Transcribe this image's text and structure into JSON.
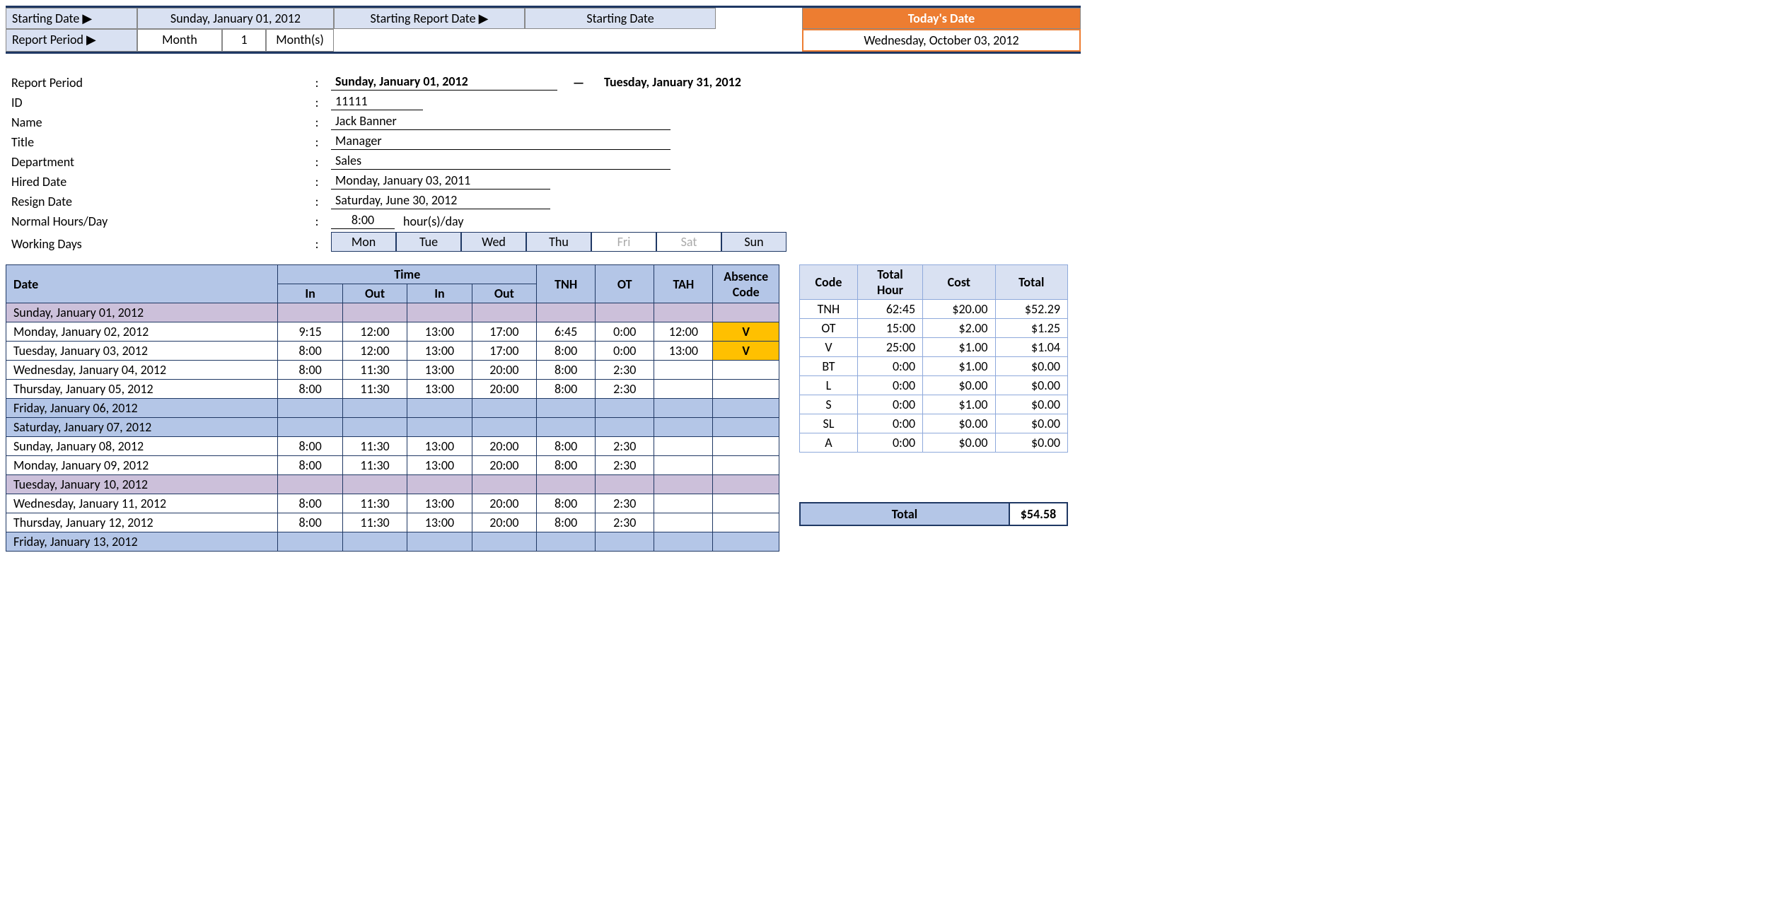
{
  "top": {
    "startingDateLabel": "Starting Date ▶",
    "startingDateValue": "Sunday, January 01, 2012",
    "startingReportDateLabel": "Starting Report Date ▶",
    "startingReportDateValue": "Starting Date",
    "reportPeriodLabel": "Report Period ▶",
    "reportPeriodUnit": "Month",
    "reportPeriodNum": "1",
    "reportPeriodSuffix": "Month(s)",
    "todaysDateLabel": "Today's Date",
    "todaysDateValue": "Wednesday, October 03, 2012"
  },
  "info": {
    "reportPeriodLabel": "Report Period",
    "periodStart": "Sunday, January 01, 2012",
    "periodDash": "—",
    "periodEnd": "Tuesday, January 31, 2012",
    "idLabel": "ID",
    "idValue": "11111",
    "nameLabel": "Name",
    "nameValue": "Jack Banner",
    "titleLabel": "Title",
    "titleValue": "Manager",
    "departmentLabel": "Department",
    "departmentValue": "Sales",
    "hiredDateLabel": "Hired Date",
    "hiredDateValue": "Monday, January 03, 2011",
    "resignDateLabel": "Resign Date",
    "resignDateValue": "Saturday, June 30, 2012",
    "normalHoursLabel": "Normal Hours/Day",
    "normalHoursValue": "8:00",
    "normalHoursSuffix": "hour(s)/day",
    "workingDaysLabel": "Working Days",
    "days": [
      "Mon",
      "Tue",
      "Wed",
      "Thu",
      "Fri",
      "Sat",
      "Sun"
    ]
  },
  "mainTable": {
    "headers": {
      "date": "Date",
      "time": "Time",
      "in": "In",
      "out": "Out",
      "tnh": "TNH",
      "ot": "OT",
      "tah": "TAH",
      "absence": "Absence Code"
    },
    "rows": [
      {
        "cls": "purple",
        "date": "Sunday, January 01, 2012",
        "in1": "",
        "out1": "",
        "in2": "",
        "out2": "",
        "tnh": "",
        "ot": "",
        "tah": "",
        "abs": ""
      },
      {
        "cls": "",
        "date": "Monday, January 02, 2012",
        "in1": "9:15",
        "out1": "12:00",
        "in2": "13:00",
        "out2": "17:00",
        "tnh": "6:45",
        "ot": "0:00",
        "tah": "12:00",
        "abs": "V"
      },
      {
        "cls": "",
        "date": "Tuesday, January 03, 2012",
        "in1": "8:00",
        "out1": "12:00",
        "in2": "13:00",
        "out2": "17:00",
        "tnh": "8:00",
        "ot": "0:00",
        "tah": "13:00",
        "abs": "V"
      },
      {
        "cls": "",
        "date": "Wednesday, January 04, 2012",
        "in1": "8:00",
        "out1": "11:30",
        "in2": "13:00",
        "out2": "20:00",
        "tnh": "8:00",
        "ot": "2:30",
        "tah": "",
        "abs": ""
      },
      {
        "cls": "",
        "date": "Thursday, January 05, 2012",
        "in1": "8:00",
        "out1": "11:30",
        "in2": "13:00",
        "out2": "20:00",
        "tnh": "8:00",
        "ot": "2:30",
        "tah": "",
        "abs": ""
      },
      {
        "cls": "blue",
        "date": "Friday, January 06, 2012",
        "in1": "",
        "out1": "",
        "in2": "",
        "out2": "",
        "tnh": "",
        "ot": "",
        "tah": "",
        "abs": ""
      },
      {
        "cls": "blue",
        "date": "Saturday, January 07, 2012",
        "in1": "",
        "out1": "",
        "in2": "",
        "out2": "",
        "tnh": "",
        "ot": "",
        "tah": "",
        "abs": ""
      },
      {
        "cls": "",
        "date": "Sunday, January 08, 2012",
        "in1": "8:00",
        "out1": "11:30",
        "in2": "13:00",
        "out2": "20:00",
        "tnh": "8:00",
        "ot": "2:30",
        "tah": "",
        "abs": ""
      },
      {
        "cls": "",
        "date": "Monday, January 09, 2012",
        "in1": "8:00",
        "out1": "11:30",
        "in2": "13:00",
        "out2": "20:00",
        "tnh": "8:00",
        "ot": "2:30",
        "tah": "",
        "abs": ""
      },
      {
        "cls": "purple",
        "date": "Tuesday, January 10, 2012",
        "in1": "",
        "out1": "",
        "in2": "",
        "out2": "",
        "tnh": "",
        "ot": "",
        "tah": "",
        "abs": ""
      },
      {
        "cls": "",
        "date": "Wednesday, January 11, 2012",
        "in1": "8:00",
        "out1": "11:30",
        "in2": "13:00",
        "out2": "20:00",
        "tnh": "8:00",
        "ot": "2:30",
        "tah": "",
        "abs": ""
      },
      {
        "cls": "",
        "date": "Thursday, January 12, 2012",
        "in1": "8:00",
        "out1": "11:30",
        "in2": "13:00",
        "out2": "20:00",
        "tnh": "8:00",
        "ot": "2:30",
        "tah": "",
        "abs": ""
      },
      {
        "cls": "blue",
        "date": "Friday, January 13, 2012",
        "in1": "",
        "out1": "",
        "in2": "",
        "out2": "",
        "tnh": "",
        "ot": "",
        "tah": "",
        "abs": ""
      }
    ]
  },
  "summary": {
    "headers": {
      "code": "Code",
      "totalHour": "Total Hour",
      "cost": "Cost",
      "total": "Total"
    },
    "rows": [
      {
        "code": "TNH",
        "hour": "62:45",
        "cost": "$20.00",
        "total": "$52.29"
      },
      {
        "code": "OT",
        "hour": "15:00",
        "cost": "$2.00",
        "total": "$1.25"
      },
      {
        "code": "V",
        "hour": "25:00",
        "cost": "$1.00",
        "total": "$1.04"
      },
      {
        "code": "BT",
        "hour": "0:00",
        "cost": "$1.00",
        "total": "$0.00"
      },
      {
        "code": "L",
        "hour": "0:00",
        "cost": "$0.00",
        "total": "$0.00"
      },
      {
        "code": "S",
        "hour": "0:00",
        "cost": "$1.00",
        "total": "$0.00"
      },
      {
        "code": "SL",
        "hour": "0:00",
        "cost": "$0.00",
        "total": "$0.00"
      },
      {
        "code": "A",
        "hour": "0:00",
        "cost": "$0.00",
        "total": "$0.00"
      }
    ]
  },
  "grandTotal": {
    "label": "Total",
    "value": "$54.58"
  }
}
